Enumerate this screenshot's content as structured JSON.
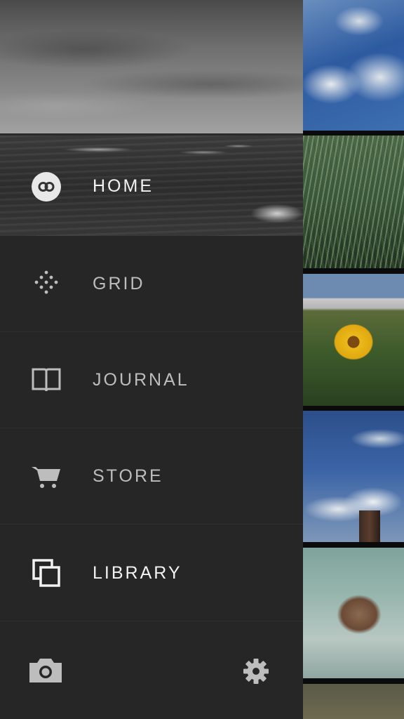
{
  "menu": {
    "items": [
      {
        "id": "home",
        "label": "HOME",
        "icon": "vsco-logo-icon",
        "active": true
      },
      {
        "id": "grid",
        "label": "GRID",
        "icon": "grid-dots-icon",
        "active": false
      },
      {
        "id": "journal",
        "label": "JOURNAL",
        "icon": "book-icon",
        "active": false
      },
      {
        "id": "store",
        "label": "STORE",
        "icon": "cart-icon",
        "active": false
      },
      {
        "id": "library",
        "label": "LIBRARY",
        "icon": "stacked-squares-icon",
        "active": true
      }
    ]
  },
  "bottom_bar": {
    "left_icon": "camera-icon",
    "right_icon": "gear-icon"
  },
  "photo_strip": {
    "photos": [
      {
        "subject": "clouds-blue-sky"
      },
      {
        "subject": "tall-grass"
      },
      {
        "subject": "sunflower"
      },
      {
        "subject": "clouds-tower"
      },
      {
        "subject": "peeling-wall"
      },
      {
        "subject": "field"
      }
    ]
  },
  "colors": {
    "drawer_bg": "#262626",
    "label_default": "#bdbdbd",
    "label_active": "#f2f2f2",
    "divider": "#2f2f2f"
  }
}
